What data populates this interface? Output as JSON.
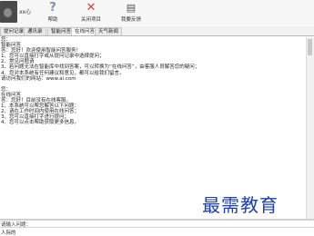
{
  "toolbar": {
    "username": "xx心",
    "help_label": "帮助",
    "close_label": "关闭项目",
    "feedback_label": "我要反馈"
  },
  "tabs": [
    {
      "label": "提问记录"
    },
    {
      "label": "通讯录"
    },
    {
      "label": "智能问答"
    },
    {
      "label": "在线问答"
    },
    {
      "label": "天气新闻"
    },
    {
      "label": ""
    }
  ],
  "chat": {
    "lines": [
      "您：",
      "  智能问答",
      "答：您好！欢迎使用智能问答服务！",
      "  1、您可以直接打字或从提问记录中选择提问；",
      "  2、常见问题请",
      "3、若问题无法在智能库中找到答案，可以转换为“在线问答”，由客服人员解答您的疑问；",
      "  4、您对本系统有任何建议和意见，都可以给我们留言。",
      "  请访问我们的网站：www.ai.com"
    ],
    "lines2": [
      "您：",
      "  在线问答",
      "答：您好！目前没有在线客服。",
      "  1、本系统可以帮您解答以下问题：",
      "  2、请在工作时间内使用在线问答；",
      "  3、您可以直接打字进行提问；",
      "  4、您可以点击帮助获取更多信息。"
    ]
  },
  "watermark": "最需教育",
  "input": {
    "label": "请输入问题：",
    "value": "人际的"
  }
}
